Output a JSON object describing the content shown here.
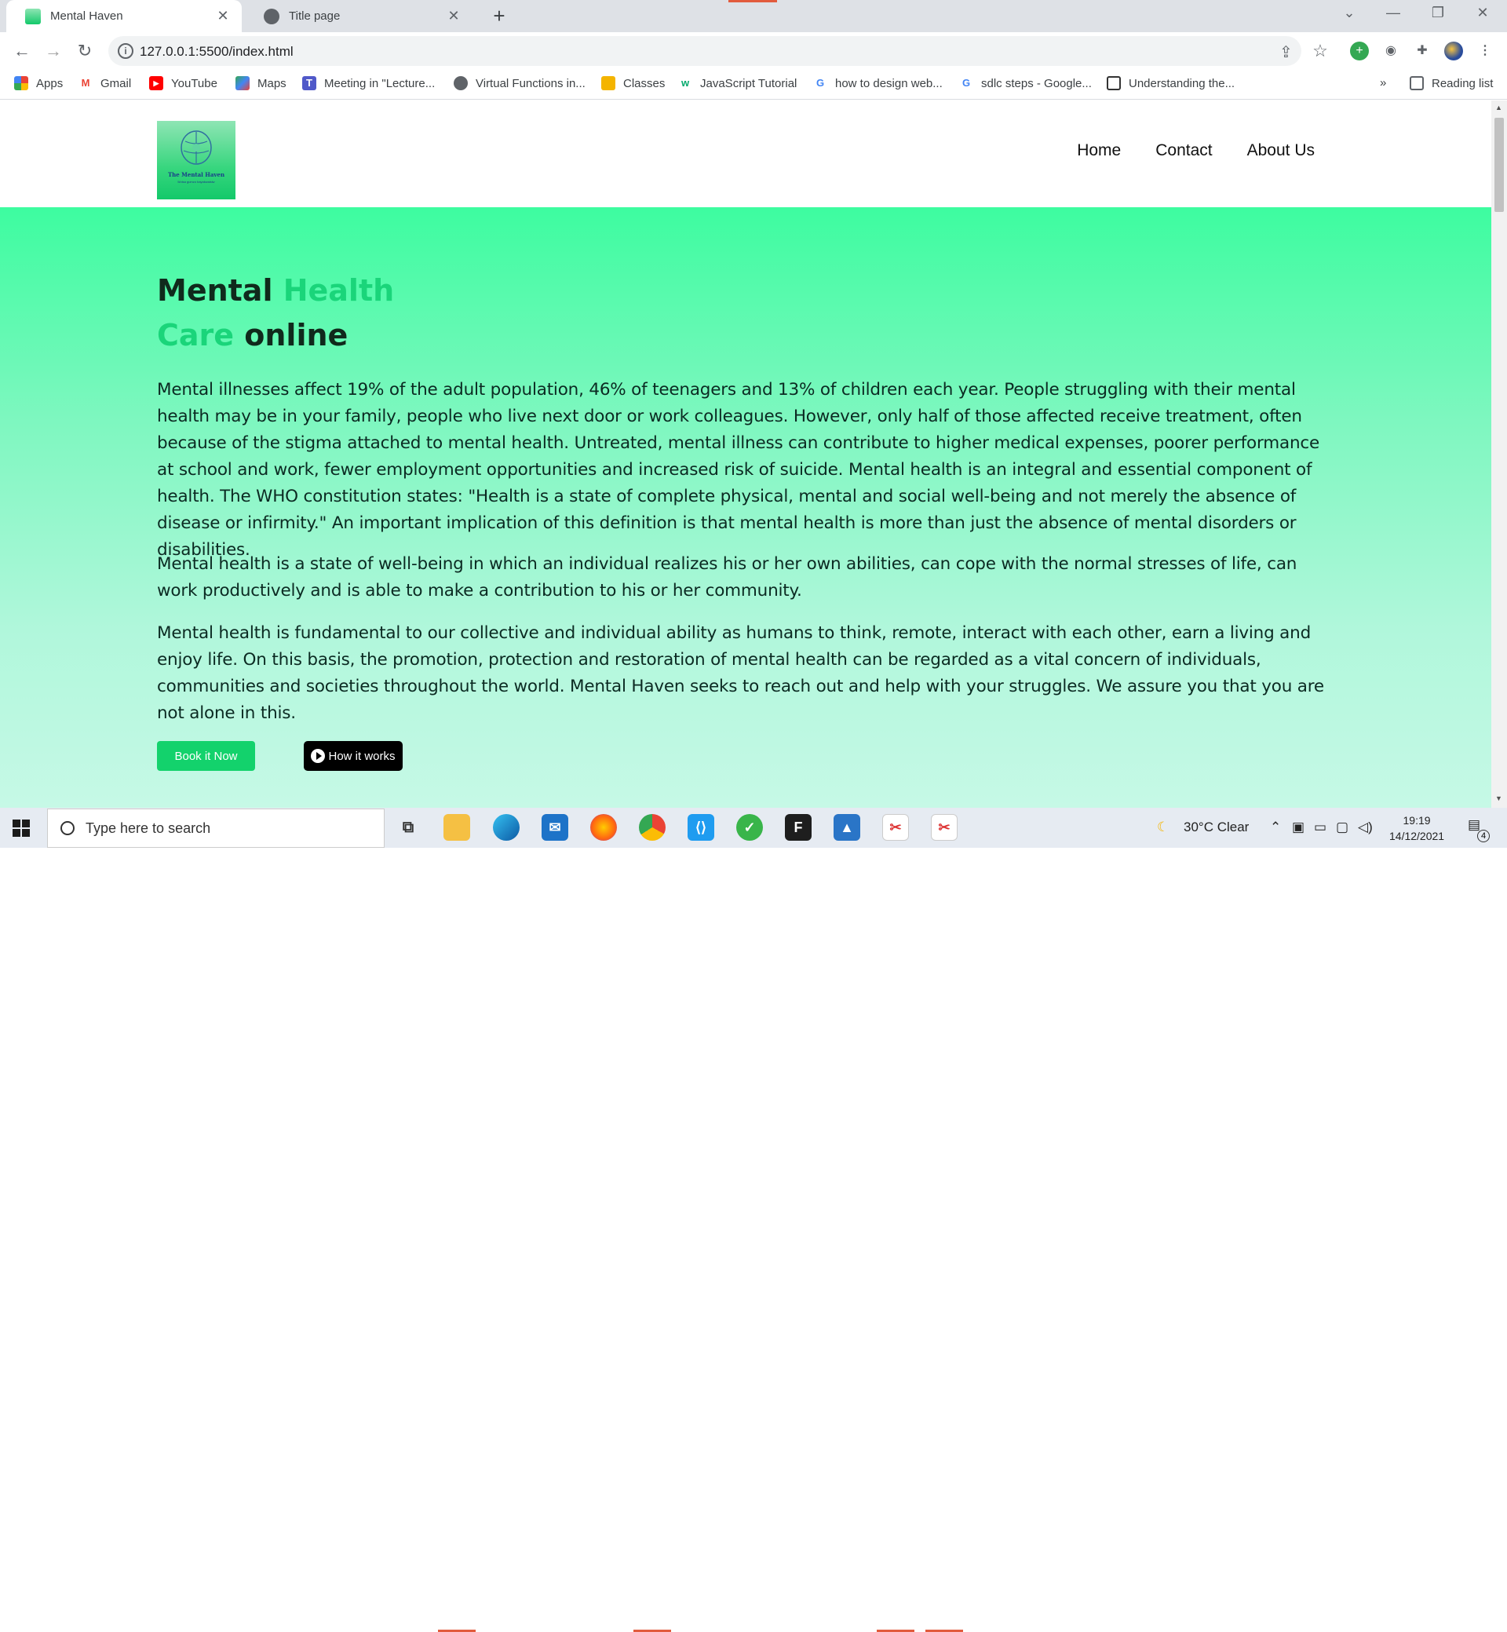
{
  "browser": {
    "tabs": [
      {
        "title": "Mental Haven",
        "active": true
      },
      {
        "title": "Title page",
        "active": false
      }
    ],
    "url": "127.0.0.1:5500/index.html",
    "bookmarks": [
      {
        "label": "Apps",
        "icon": "apps-grid-icon"
      },
      {
        "label": "Gmail",
        "icon": "gmail-icon"
      },
      {
        "label": "YouTube",
        "icon": "youtube-icon"
      },
      {
        "label": "Maps",
        "icon": "maps-icon"
      },
      {
        "label": "Meeting in \"Lecture...",
        "icon": "teams-icon"
      },
      {
        "label": "Virtual Functions in...",
        "icon": "globe-icon"
      },
      {
        "label": "Classes",
        "icon": "classroom-icon"
      },
      {
        "label": "JavaScript Tutorial",
        "icon": "w3schools-icon"
      },
      {
        "label": "how to design web...",
        "icon": "google-icon"
      },
      {
        "label": "sdlc steps - Google...",
        "icon": "google-icon"
      },
      {
        "label": "Understanding the...",
        "icon": "page-icon"
      }
    ],
    "overflow": "»",
    "reading_list": "Reading list"
  },
  "site": {
    "logo": {
      "title": "The Mental Haven",
      "tagline": "Ikhisa gumzo bayakwaisiw"
    },
    "nav": [
      "Home",
      "Contact",
      "About Us"
    ],
    "hero": {
      "title_parts": [
        "Mental ",
        "Health",
        "Care",
        " online"
      ],
      "paragraphs": [
        "Mental illnesses affect 19% of the adult population, 46% of teenagers and 13% of children each year. People struggling with their mental health may be in your family, people who live next door or work colleagues. However, only half of those affected receive treatment, often because of the stigma attached to mental health. Untreated, mental illness can contribute to higher medical expenses, poorer performance at school and work, fewer employment opportunities and increased risk of suicide. Mental health is an integral and essential component of health. The WHO constitution states: \"Health is a state of complete physical, mental and social well-being and not merely the absence of disease or infirmity.\" An important implication of this definition is that mental health is more than just the absence of mental disorders or disabilities.",
        "Mental health is a state of well-being in which an individual realizes his or her own abilities, can cope with the normal stresses of life, can work productively and is able to make a contribution to his or her community.",
        "Mental health is fundamental to our collective and individual ability as humans to think, remote, interact with each other, earn a living and enjoy life. On this basis, the promotion, protection and restoration of mental health can be regarded as a vital concern of individuals, communities and societies throughout the world. Mental Haven seeks to reach out and help with your struggles. We assure you that you are not alone in this."
      ],
      "buttons": {
        "book": "Book it Now",
        "how": "How it works"
      }
    }
  },
  "taskbar": {
    "search_placeholder": "Type here to search",
    "weather": "30°C  Clear",
    "time": "19:19",
    "date": "14/12/2021",
    "notification_count": "4"
  },
  "colors": {
    "accent_green": "#1ad57a",
    "button_green": "#13d26c",
    "hero_top": "#3dfca0",
    "hero_bottom": "#c6f9e6"
  }
}
